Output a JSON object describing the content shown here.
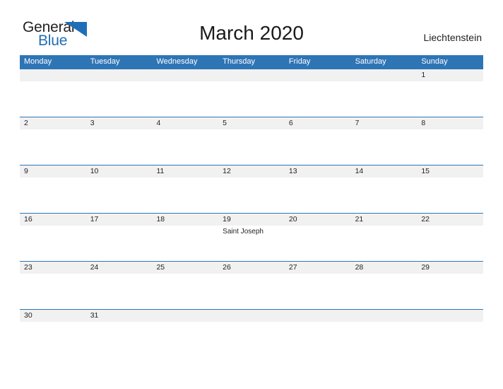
{
  "brand": {
    "name_part1": "General",
    "name_part2": "Blue",
    "flag_color": "#1e6fb8",
    "text_color": "#231f20"
  },
  "header": {
    "title": "March 2020",
    "country": "Liechtenstein"
  },
  "theme": {
    "header_blue": "#2e75b6",
    "row_band_gray": "#f1f1f1",
    "separator_blue": "#2e75b6",
    "text_dark": "#231f20",
    "weekday_text": "#ffffff"
  },
  "calendar": {
    "weekdays": [
      "Monday",
      "Tuesday",
      "Wednesday",
      "Thursday",
      "Friday",
      "Saturday",
      "Sunday"
    ],
    "weeks": [
      {
        "days": [
          {
            "num": "",
            "event": ""
          },
          {
            "num": "",
            "event": ""
          },
          {
            "num": "",
            "event": ""
          },
          {
            "num": "",
            "event": ""
          },
          {
            "num": "",
            "event": ""
          },
          {
            "num": "",
            "event": ""
          },
          {
            "num": "1",
            "event": ""
          }
        ]
      },
      {
        "days": [
          {
            "num": "2",
            "event": ""
          },
          {
            "num": "3",
            "event": ""
          },
          {
            "num": "4",
            "event": ""
          },
          {
            "num": "5",
            "event": ""
          },
          {
            "num": "6",
            "event": ""
          },
          {
            "num": "7",
            "event": ""
          },
          {
            "num": "8",
            "event": ""
          }
        ]
      },
      {
        "days": [
          {
            "num": "9",
            "event": ""
          },
          {
            "num": "10",
            "event": ""
          },
          {
            "num": "11",
            "event": ""
          },
          {
            "num": "12",
            "event": ""
          },
          {
            "num": "13",
            "event": ""
          },
          {
            "num": "14",
            "event": ""
          },
          {
            "num": "15",
            "event": ""
          }
        ]
      },
      {
        "days": [
          {
            "num": "16",
            "event": ""
          },
          {
            "num": "17",
            "event": ""
          },
          {
            "num": "18",
            "event": ""
          },
          {
            "num": "19",
            "event": "Saint Joseph"
          },
          {
            "num": "20",
            "event": ""
          },
          {
            "num": "21",
            "event": ""
          },
          {
            "num": "22",
            "event": ""
          }
        ]
      },
      {
        "days": [
          {
            "num": "23",
            "event": ""
          },
          {
            "num": "24",
            "event": ""
          },
          {
            "num": "25",
            "event": ""
          },
          {
            "num": "26",
            "event": ""
          },
          {
            "num": "27",
            "event": ""
          },
          {
            "num": "28",
            "event": ""
          },
          {
            "num": "29",
            "event": ""
          }
        ]
      },
      {
        "days": [
          {
            "num": "30",
            "event": ""
          },
          {
            "num": "31",
            "event": ""
          },
          {
            "num": "",
            "event": ""
          },
          {
            "num": "",
            "event": ""
          },
          {
            "num": "",
            "event": ""
          },
          {
            "num": "",
            "event": ""
          },
          {
            "num": "",
            "event": ""
          }
        ]
      }
    ]
  }
}
